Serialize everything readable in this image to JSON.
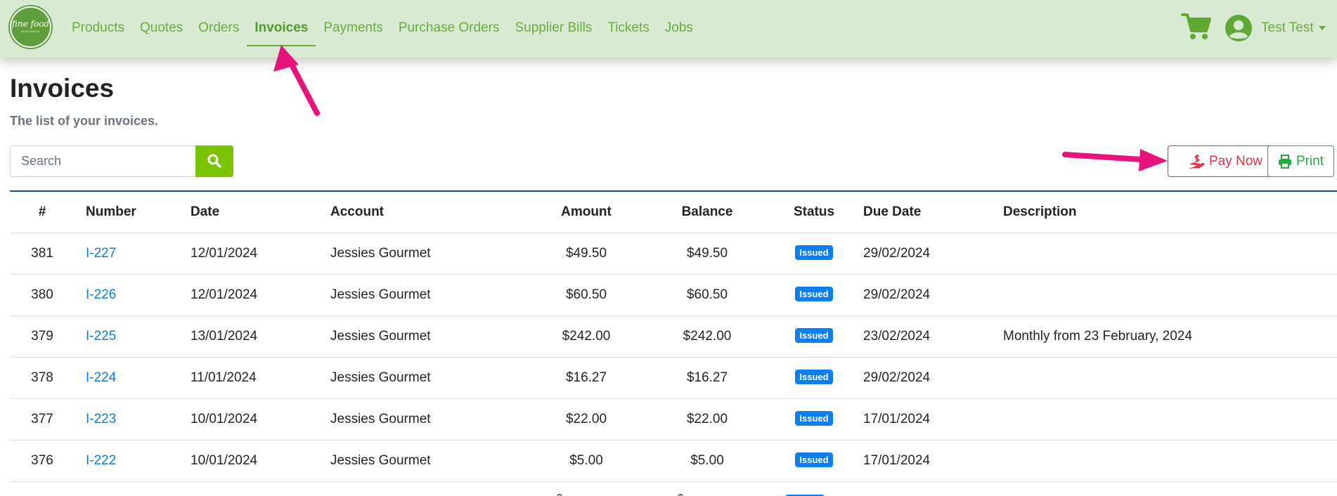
{
  "brand": {
    "logo_line1": "fine food",
    "logo_line2": "AUSTRALIA"
  },
  "nav": {
    "items": [
      {
        "label": "Products"
      },
      {
        "label": "Quotes"
      },
      {
        "label": "Orders"
      },
      {
        "label": "Invoices",
        "active": true
      },
      {
        "label": "Payments"
      },
      {
        "label": "Purchase Orders"
      },
      {
        "label": "Supplier Bills"
      },
      {
        "label": "Tickets"
      },
      {
        "label": "Jobs"
      }
    ],
    "cart_icon": "shopping-cart-icon",
    "user_icon": "user-circle-icon",
    "user_name": "Test Test"
  },
  "page": {
    "title": "Invoices",
    "subtitle": "The list of your invoices."
  },
  "search": {
    "placeholder": "Search",
    "value": "",
    "icon": "search-icon"
  },
  "actions": {
    "pay_now_label": "Pay Now",
    "pay_now_icon": "hand-holding-dollar-icon",
    "print_label": "Print",
    "print_icon": "print-icon"
  },
  "table": {
    "headers": [
      "#",
      "Number",
      "Date",
      "Account",
      "Amount",
      "Balance",
      "Status",
      "Due Date",
      "Description"
    ],
    "rows": [
      {
        "id": "381",
        "number": "I-227",
        "date": "12/01/2024",
        "account": "Jessies Gourmet",
        "amount": "$49.50",
        "balance": "$49.50",
        "status": "Issued",
        "due_date": "29/02/2024",
        "description": ""
      },
      {
        "id": "380",
        "number": "I-226",
        "date": "12/01/2024",
        "account": "Jessies Gourmet",
        "amount": "$60.50",
        "balance": "$60.50",
        "status": "Issued",
        "due_date": "29/02/2024",
        "description": ""
      },
      {
        "id": "379",
        "number": "I-225",
        "date": "13/01/2024",
        "account": "Jessies Gourmet",
        "amount": "$242.00",
        "balance": "$242.00",
        "status": "Issued",
        "due_date": "23/02/2024",
        "description": "Monthly from 23 February, 2024"
      },
      {
        "id": "378",
        "number": "I-224",
        "date": "11/01/2024",
        "account": "Jessies Gourmet",
        "amount": "$16.27",
        "balance": "$16.27",
        "status": "Issued",
        "due_date": "29/02/2024",
        "description": ""
      },
      {
        "id": "377",
        "number": "I-223",
        "date": "10/01/2024",
        "account": "Jessies Gourmet",
        "amount": "$22.00",
        "balance": "$22.00",
        "status": "Issued",
        "due_date": "17/01/2024",
        "description": ""
      },
      {
        "id": "376",
        "number": "I-222",
        "date": "10/01/2024",
        "account": "Jessies Gourmet",
        "amount": "$5.00",
        "balance": "$5.00",
        "status": "Issued",
        "due_date": "17/01/2024",
        "description": ""
      }
    ]
  },
  "colors": {
    "navbar_bg": "#d9ead3",
    "nav_text": "#6aab3e",
    "search_button": "#7cc400",
    "pay_now": "#dc3545",
    "print": "#28a745",
    "status_badge": "#0d7ef0",
    "link": "#0b7dda",
    "annotation_arrow": "#e8137a"
  }
}
